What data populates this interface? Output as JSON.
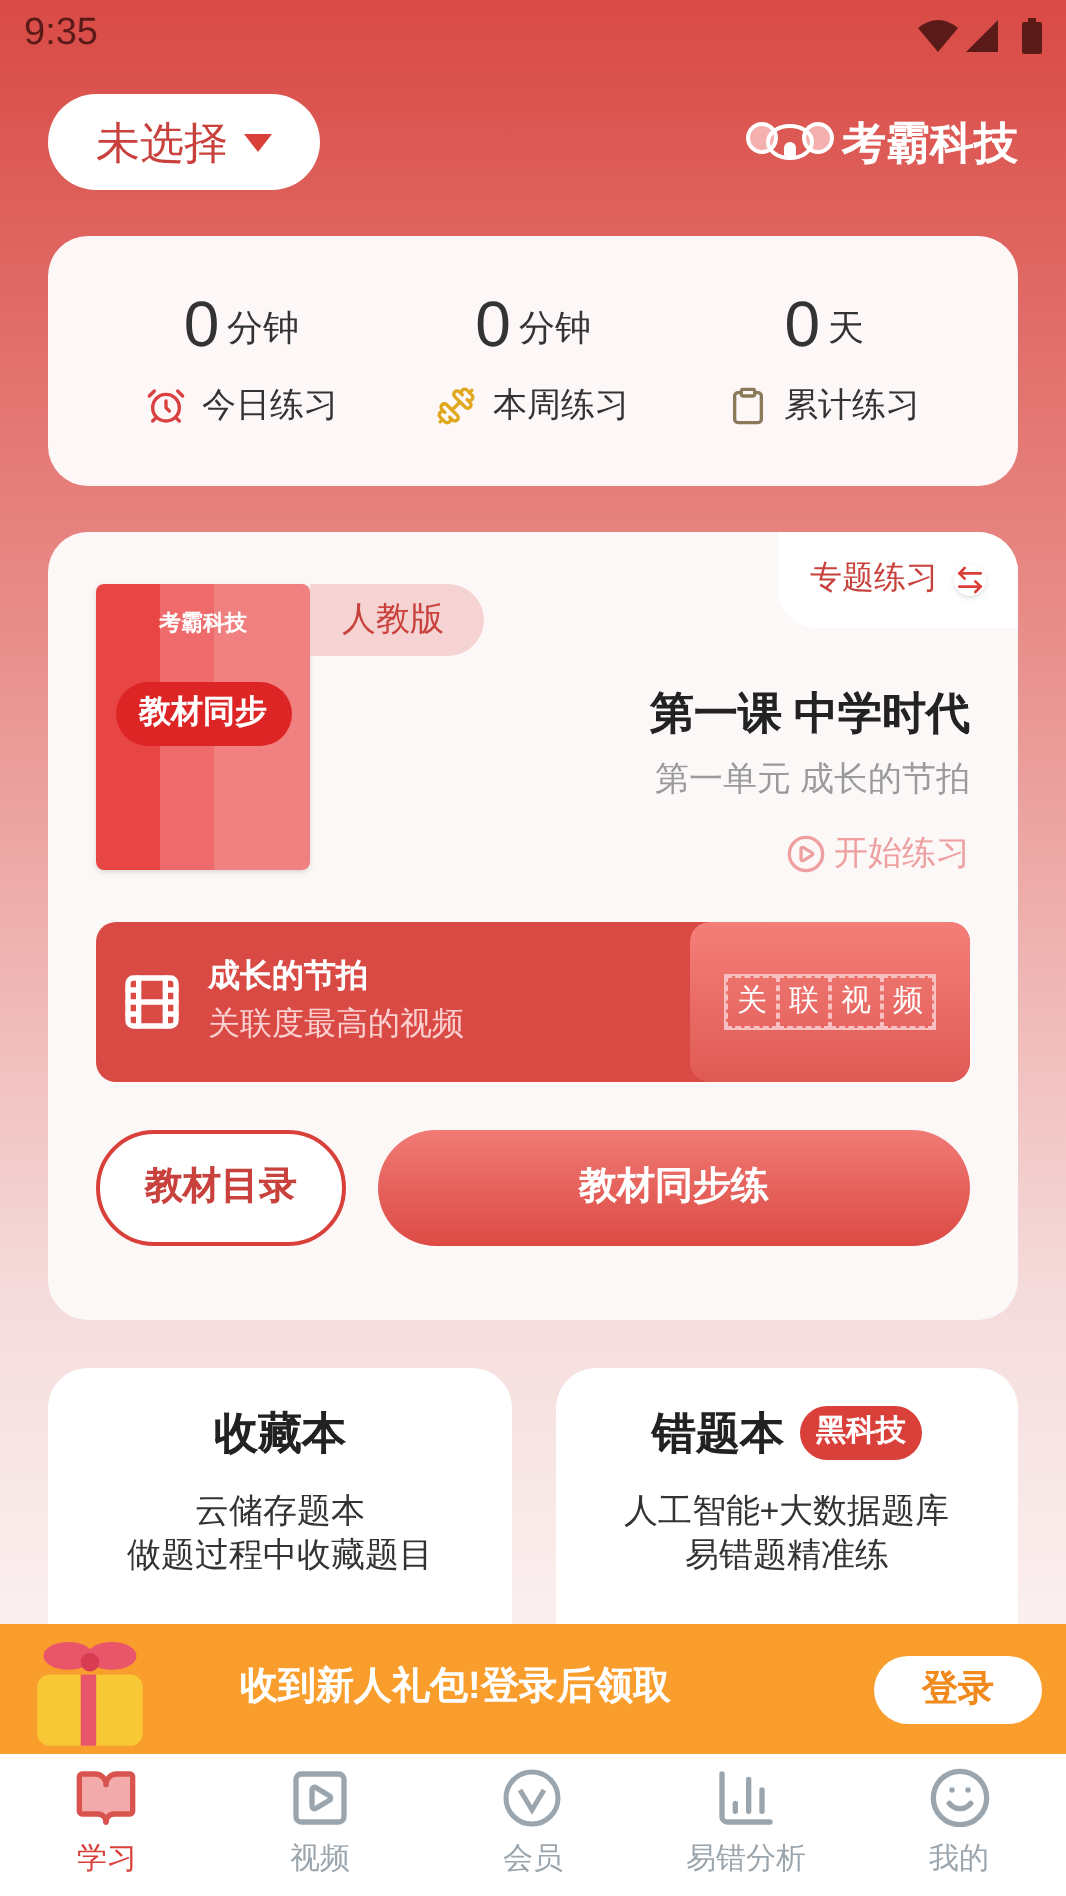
{
  "status_bar": {
    "time": "9:35"
  },
  "header": {
    "grade_selector": "未选择",
    "brand": "考霸科技"
  },
  "stats": [
    {
      "kind": "today",
      "value": "0",
      "unit": "分钟",
      "label": "今日练习"
    },
    {
      "kind": "week",
      "value": "0",
      "unit": "分钟",
      "label": "本周练习"
    },
    {
      "kind": "total",
      "value": "0",
      "unit": "天",
      "label": "累计练习"
    }
  ],
  "textbook": {
    "cover_brand": "考霸科技",
    "cover_label": "教材同步",
    "edition": "人教版",
    "topic_button": "专题练习",
    "lesson_title": "第一课 中学时代",
    "unit": "第一单元 成长的节拍",
    "start": "开始练习",
    "video": {
      "title": "成长的节拍",
      "subtitle": "关联度最高的视频",
      "tag_chars": [
        "关",
        "联",
        "视",
        "频"
      ]
    },
    "catalog_button": "教材目录",
    "practice_button": "教材同步练"
  },
  "books": [
    {
      "title": "收藏本",
      "lines": [
        "云储存题本",
        "做题过程中收藏题目"
      ]
    },
    {
      "title": "错题本",
      "badge": "黑科技",
      "lines": [
        "人工智能+大数据题库",
        "易错题精准练"
      ]
    }
  ],
  "banner": {
    "text": "收到新人礼包!登录后领取",
    "button": "登录"
  },
  "nav": [
    {
      "kind": "book",
      "label": "学习",
      "selected": true
    },
    {
      "kind": "video",
      "label": "视频",
      "selected": false
    },
    {
      "kind": "vip",
      "label": "会员",
      "selected": false
    },
    {
      "kind": "chart",
      "label": "易错分析",
      "selected": false
    },
    {
      "kind": "user",
      "label": "我的",
      "selected": false
    }
  ]
}
